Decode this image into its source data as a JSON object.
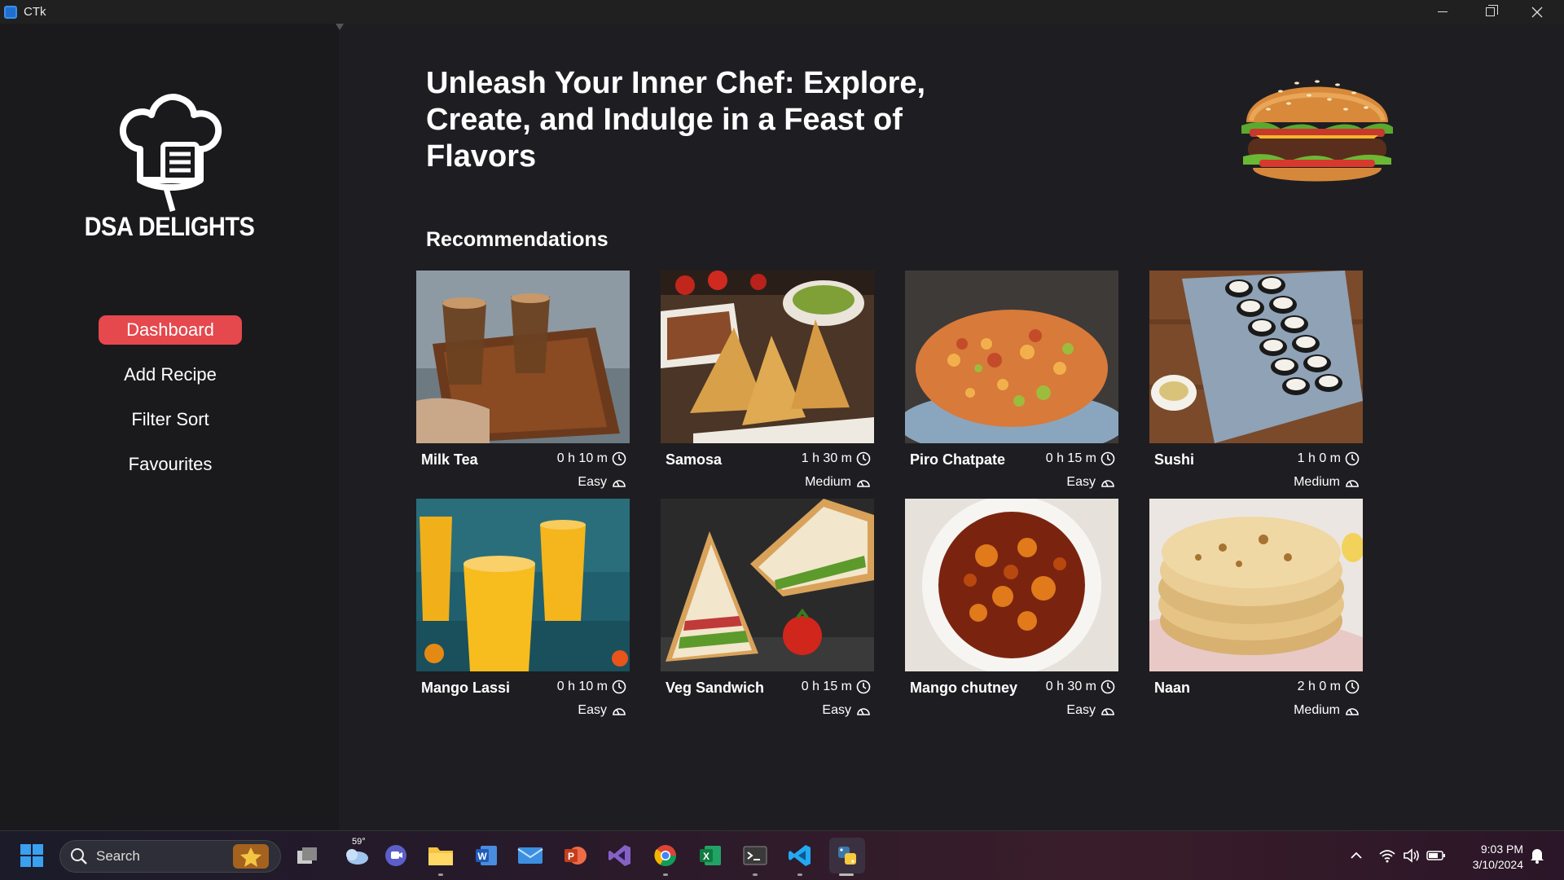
{
  "window": {
    "title": "CTk"
  },
  "brand": {
    "name": "DSA DELIGHTS"
  },
  "nav": [
    {
      "label": "Dashboard",
      "active": true
    },
    {
      "label": "Add Recipe",
      "active": false
    },
    {
      "label": "Filter Sort",
      "active": false
    },
    {
      "label": "Favourites",
      "active": false
    }
  ],
  "hero": {
    "headline": "Unleash Your Inner Chef: Explore, Create, and Indulge in a Feast of Flavors"
  },
  "recommendations": {
    "title": "Recommendations",
    "items": [
      {
        "name": "Milk Tea",
        "time": "0 h 10 m",
        "difficulty": "Easy",
        "image": "milk-tea"
      },
      {
        "name": "Samosa",
        "time": "1 h 30 m",
        "difficulty": "Medium",
        "image": "samosa"
      },
      {
        "name": "Piro Chatpate",
        "time": "0 h 15 m",
        "difficulty": "Easy",
        "image": "piro-chatpate"
      },
      {
        "name": "Sushi",
        "time": "1 h 0 m",
        "difficulty": "Medium",
        "image": "sushi"
      },
      {
        "name": "Mango Lassi",
        "time": "0 h 10 m",
        "difficulty": "Easy",
        "image": "mango-lassi"
      },
      {
        "name": "Veg Sandwich",
        "time": "0 h 15 m",
        "difficulty": "Easy",
        "image": "veg-sandwich"
      },
      {
        "name": "Mango chutney",
        "time": "0 h 30 m",
        "difficulty": "Easy",
        "image": "mango-chutney"
      },
      {
        "name": "Naan",
        "time": "2 h 0 m",
        "difficulty": "Medium",
        "image": "naan"
      }
    ]
  },
  "taskbar": {
    "search_label": "Search",
    "weather": "59°",
    "time": "9:03 PM",
    "date": "3/10/2024"
  },
  "colors": {
    "accent": "#e5484d",
    "background": "#1e1e22",
    "sidebar": "#1a1a1c"
  }
}
